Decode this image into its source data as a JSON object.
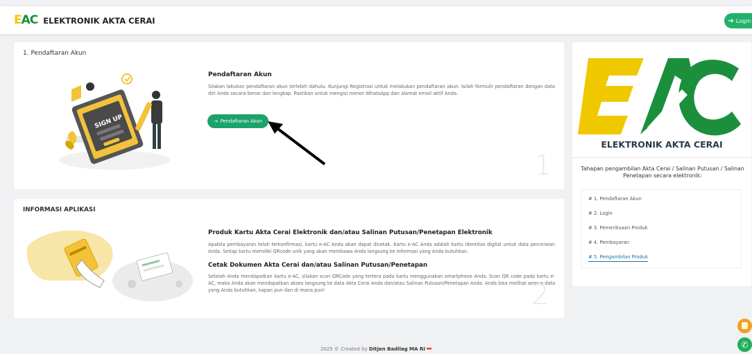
{
  "navbar": {
    "logo_text_y": "E",
    "logo_text_g": "AC",
    "title": "ELEKTRONIK AKTA CERAI",
    "login_label": "Login"
  },
  "card1": {
    "title": "1. Pendaftaran Akun",
    "heading": "Pendaftaran Akun",
    "text": "Silakan lakukan pendaftaran akun terlebih dahulu. Kunjungi Registrasi untuk melakukan pendaftaran akun. Isilah formulir pendaftaran dengan data diri Anda secara benar dan lengkap. Pastikan untuk mengisi nomor WhatsApp dan alamat email aktif Anda.",
    "button_label": "Pendaftaran Akun",
    "step_number": "1",
    "illustration_text": "SIGN UP"
  },
  "card2": {
    "title": "INFORMASI APLIKASI",
    "heading1": "Produk Kartu Akta Cerai Elektronik dan/atau Salinan Putusan/Penetapan Elektronik",
    "para1": "Apabila pembayaran telah terkonfirmasi, kartu e-AC Anda akan dapat dicetak. Kartu e-AC Anda adalah kartu identitas digital untuk data perceraian Anda. Setiap kartu memiliki QRcode unik yang akan membawa Anda langsung ke informasi yang Anda butuhkan.",
    "heading2": "Cetak Dokumen Akta Cerai dan/atau Salinan Putusan/Penetapan",
    "para2": "Setelah Anda mendapatkan kartu e-AC, silakan scan QRCode yang tertera pada kartu menggunakan smartphone Anda. Scan QR code pada kartu e-AC, maka Anda akan mendapatkan akses langsung ke data Akta Cerai Anda dan/atau Salinan Putusan/Penetapan Anda. Anda bisa melihat semua data yang Anda butuhkan, kapan pun dan di mana pun!",
    "step_number": "2"
  },
  "sidebar": {
    "logo_caption": "ELEKTRONIK AKTA CERAI",
    "subtitle": "Tahapan pengambilan Akta Cerai / Salinan Putusan / Salinan Penetapan secara elektronik:",
    "steps": [
      {
        "label": "# 1. Pendaftaran Akun"
      },
      {
        "label": "# 2. Login"
      },
      {
        "label": "# 3. Pemeriksaan Produk"
      },
      {
        "label": "# 4. Pembayaran"
      },
      {
        "label": "# 5. Pengambilan Produk"
      }
    ]
  },
  "footer": {
    "prefix": "2025 © Created by ",
    "author": "Ditjen Badilag MA RI"
  },
  "colors": {
    "accent_green": "#1aa36b",
    "logo_yellow": "#f0c800",
    "logo_green": "#1b8f3c",
    "active_link": "#1b6ea8"
  }
}
